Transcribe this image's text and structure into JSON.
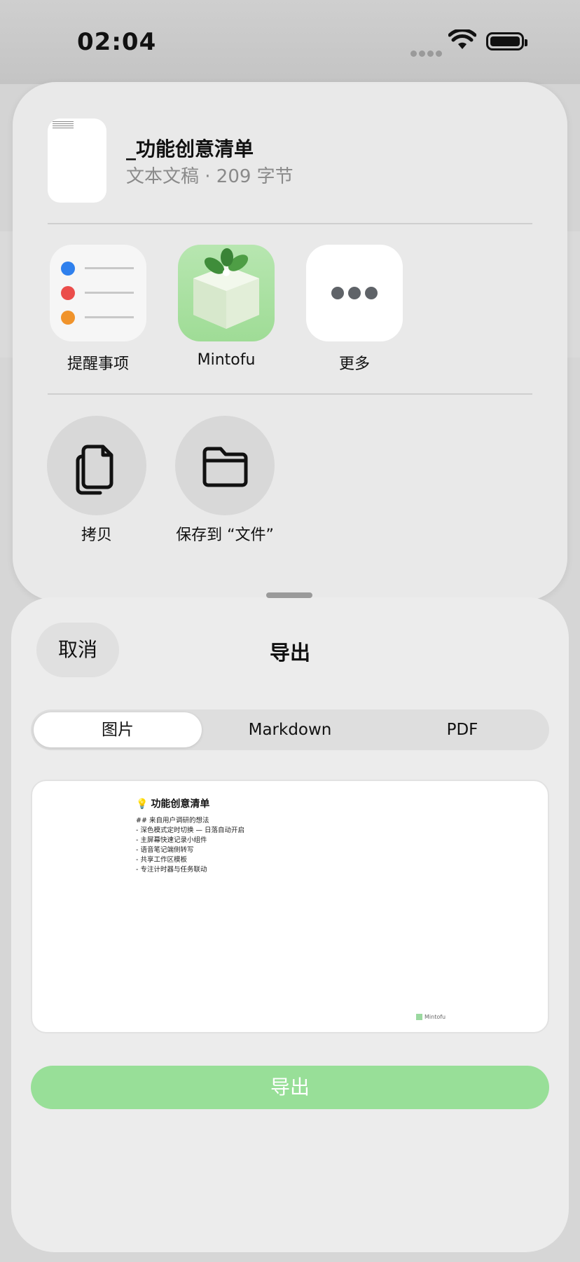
{
  "status": {
    "time": "02:04"
  },
  "share_sheet": {
    "doc_title": "_功能创意清单",
    "doc_subtitle": "文本文稿 · 209 字节",
    "apps": [
      {
        "label": "提醒事项",
        "icon": "reminders-app-icon"
      },
      {
        "label": "Mintofu",
        "icon": "mintofu-app-icon"
      },
      {
        "label": "更多",
        "icon": "more-icon"
      }
    ],
    "actions": [
      {
        "label": "拷贝",
        "icon": "copy-icon"
      },
      {
        "label": "保存到 “文件”",
        "icon": "folder-icon"
      }
    ]
  },
  "export_sheet": {
    "cancel_label": "取消",
    "title": "导出",
    "tabs": [
      "图片",
      "Markdown",
      "PDF"
    ],
    "selected_tab": "图片",
    "preview": {
      "title": "功能创意清单",
      "lines": [
        "## 来自用户调研的想法",
        "- 深色模式定时切换 — 日落自动开启",
        "- 主屏幕快速记录小组件",
        "- 语音笔记端侧转写",
        "- 共享工作区模板",
        "- 专注计时器与任务联动"
      ],
      "watermark": "Mintofu"
    },
    "export_button": "导出"
  },
  "colors": {
    "accent_green": "#98df98",
    "sheet_bg": "#ececec"
  }
}
